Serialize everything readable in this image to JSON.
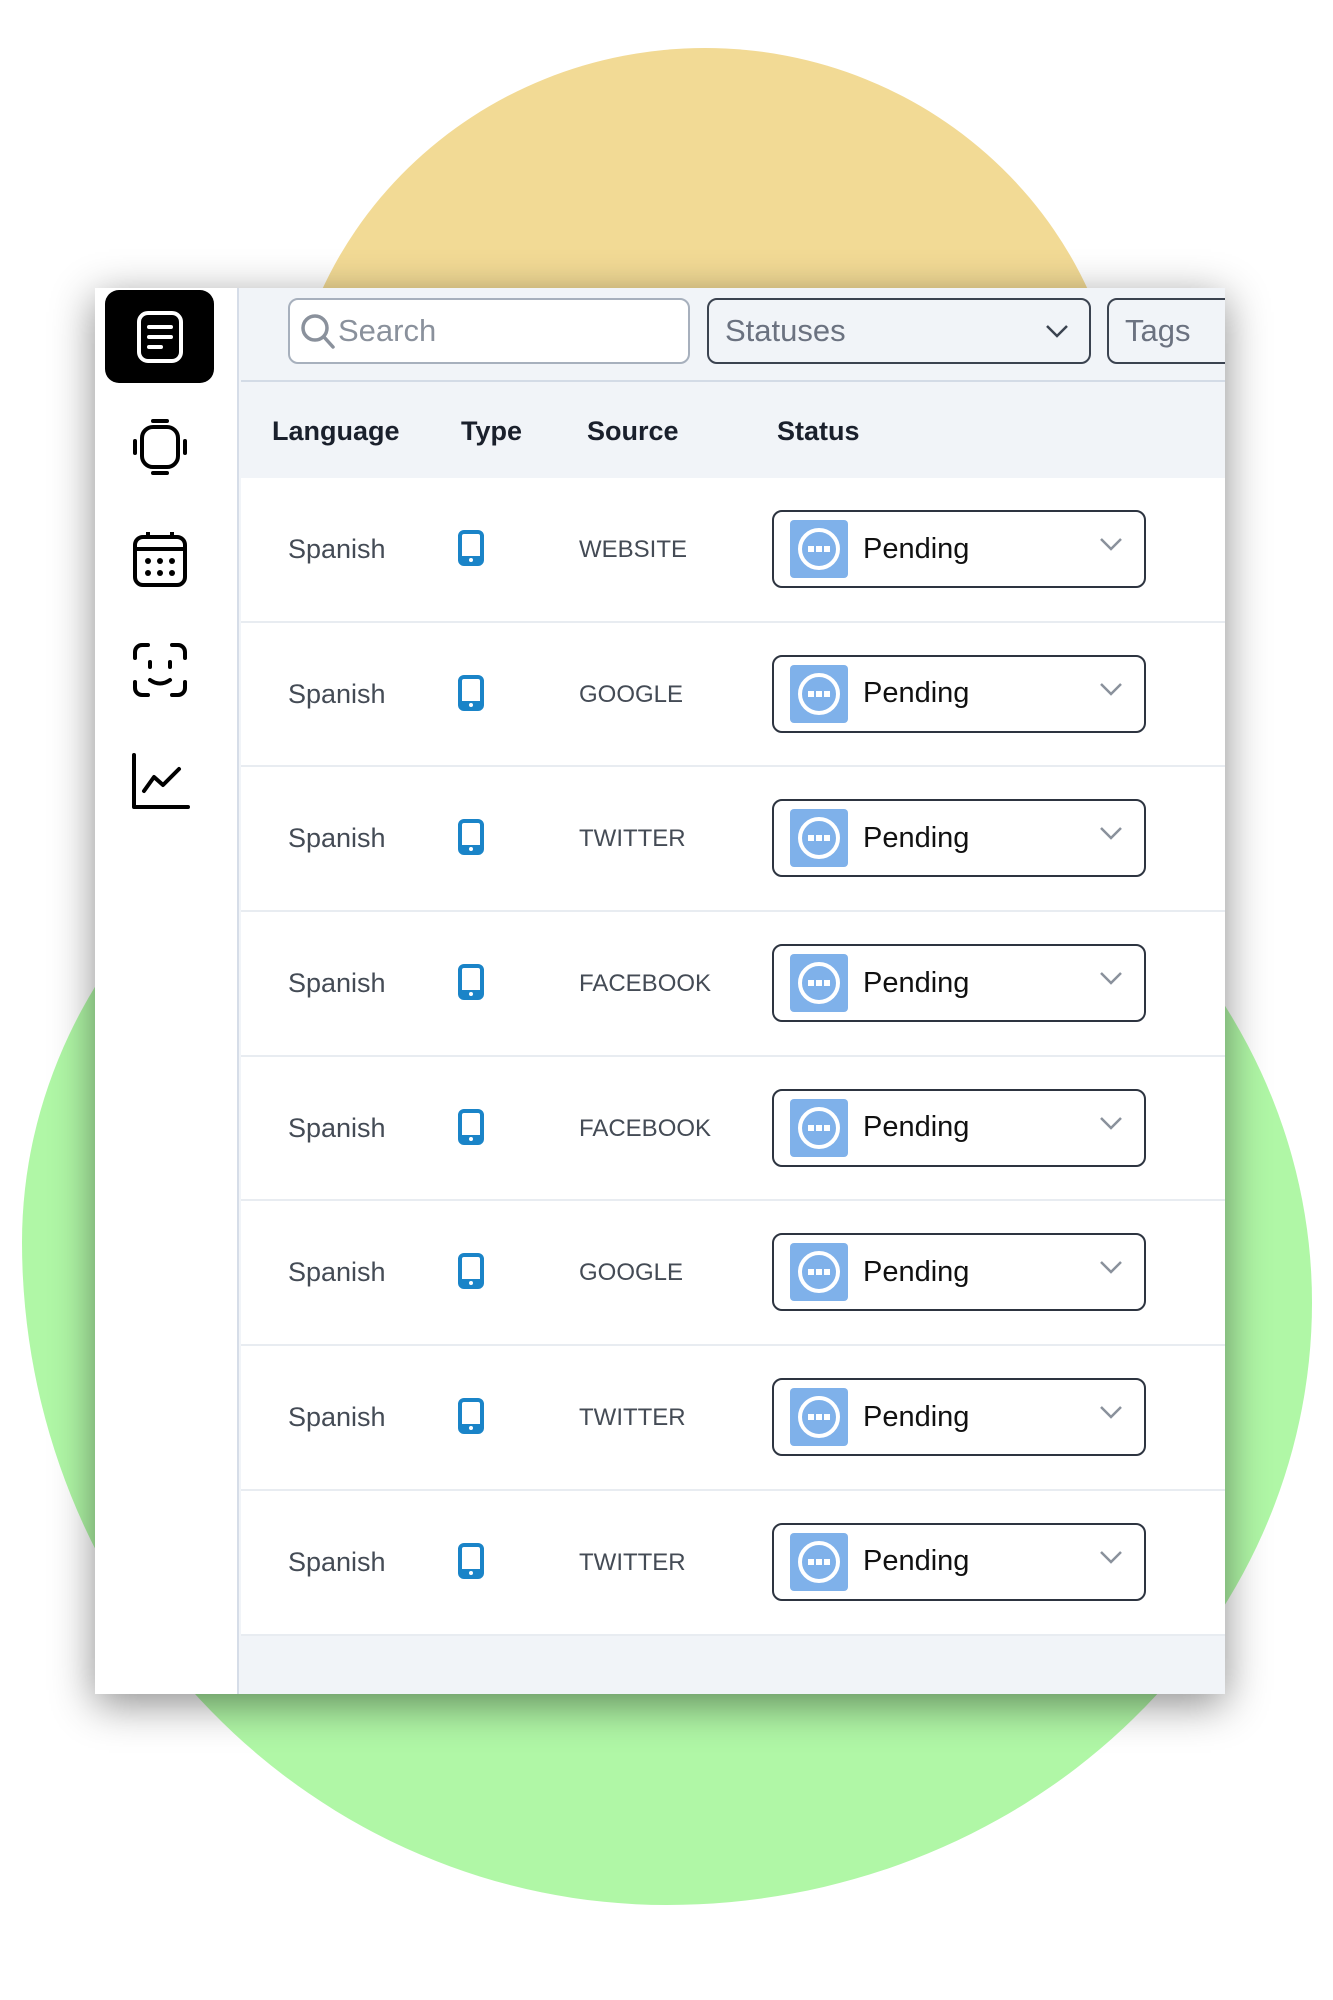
{
  "toolbar": {
    "search_placeholder": "Search",
    "statuses_label": "Statuses",
    "tags_label": "Tags"
  },
  "sidebar": {
    "items": [
      {
        "icon": "document-icon",
        "active": true
      },
      {
        "icon": "watch-icon"
      },
      {
        "icon": "calendar-icon"
      },
      {
        "icon": "face-scan-icon"
      },
      {
        "icon": "chart-line-icon"
      }
    ]
  },
  "table": {
    "headers": [
      "Language",
      "Type",
      "Source",
      "Status"
    ],
    "rows": [
      {
        "language": "Spanish",
        "type": "mobile",
        "source": "WEBSITE",
        "status": "Pending"
      },
      {
        "language": "Spanish",
        "type": "mobile",
        "source": "GOOGLE",
        "status": "Pending"
      },
      {
        "language": "Spanish",
        "type": "mobile",
        "source": "TWITTER",
        "status": "Pending"
      },
      {
        "language": "Spanish",
        "type": "mobile",
        "source": "FACEBOOK",
        "status": "Pending"
      },
      {
        "language": "Spanish",
        "type": "mobile",
        "source": "FACEBOOK",
        "status": "Pending"
      },
      {
        "language": "Spanish",
        "type": "mobile",
        "source": "GOOGLE",
        "status": "Pending"
      },
      {
        "language": "Spanish",
        "type": "mobile",
        "source": "TWITTER",
        "status": "Pending"
      },
      {
        "language": "Spanish",
        "type": "mobile",
        "source": "TWITTER",
        "status": "Pending"
      }
    ]
  },
  "colors": {
    "status_pending": "#7fb1ea",
    "phone_icon": "#1a84c8",
    "blob_yellow": "#f2da95",
    "blob_green": "#b0f7a6"
  }
}
